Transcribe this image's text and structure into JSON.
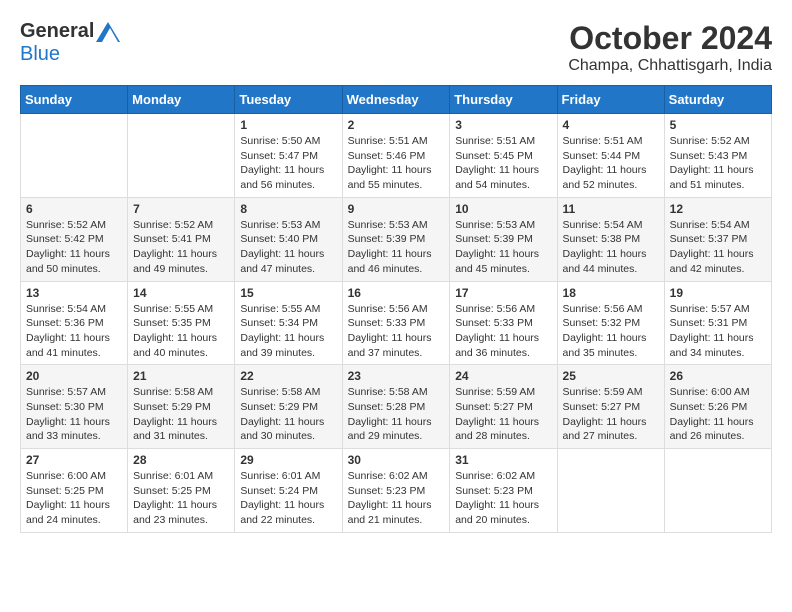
{
  "header": {
    "logo_general": "General",
    "logo_blue": "Blue",
    "month": "October 2024",
    "location": "Champa, Chhattisgarh, India"
  },
  "days_of_week": [
    "Sunday",
    "Monday",
    "Tuesday",
    "Wednesday",
    "Thursday",
    "Friday",
    "Saturday"
  ],
  "weeks": [
    [
      {
        "day": "",
        "content": ""
      },
      {
        "day": "",
        "content": ""
      },
      {
        "day": "1",
        "content": "Sunrise: 5:50 AM\nSunset: 5:47 PM\nDaylight: 11 hours and 56 minutes."
      },
      {
        "day": "2",
        "content": "Sunrise: 5:51 AM\nSunset: 5:46 PM\nDaylight: 11 hours and 55 minutes."
      },
      {
        "day": "3",
        "content": "Sunrise: 5:51 AM\nSunset: 5:45 PM\nDaylight: 11 hours and 54 minutes."
      },
      {
        "day": "4",
        "content": "Sunrise: 5:51 AM\nSunset: 5:44 PM\nDaylight: 11 hours and 52 minutes."
      },
      {
        "day": "5",
        "content": "Sunrise: 5:52 AM\nSunset: 5:43 PM\nDaylight: 11 hours and 51 minutes."
      }
    ],
    [
      {
        "day": "6",
        "content": "Sunrise: 5:52 AM\nSunset: 5:42 PM\nDaylight: 11 hours and 50 minutes."
      },
      {
        "day": "7",
        "content": "Sunrise: 5:52 AM\nSunset: 5:41 PM\nDaylight: 11 hours and 49 minutes."
      },
      {
        "day": "8",
        "content": "Sunrise: 5:53 AM\nSunset: 5:40 PM\nDaylight: 11 hours and 47 minutes."
      },
      {
        "day": "9",
        "content": "Sunrise: 5:53 AM\nSunset: 5:39 PM\nDaylight: 11 hours and 46 minutes."
      },
      {
        "day": "10",
        "content": "Sunrise: 5:53 AM\nSunset: 5:39 PM\nDaylight: 11 hours and 45 minutes."
      },
      {
        "day": "11",
        "content": "Sunrise: 5:54 AM\nSunset: 5:38 PM\nDaylight: 11 hours and 44 minutes."
      },
      {
        "day": "12",
        "content": "Sunrise: 5:54 AM\nSunset: 5:37 PM\nDaylight: 11 hours and 42 minutes."
      }
    ],
    [
      {
        "day": "13",
        "content": "Sunrise: 5:54 AM\nSunset: 5:36 PM\nDaylight: 11 hours and 41 minutes."
      },
      {
        "day": "14",
        "content": "Sunrise: 5:55 AM\nSunset: 5:35 PM\nDaylight: 11 hours and 40 minutes."
      },
      {
        "day": "15",
        "content": "Sunrise: 5:55 AM\nSunset: 5:34 PM\nDaylight: 11 hours and 39 minutes."
      },
      {
        "day": "16",
        "content": "Sunrise: 5:56 AM\nSunset: 5:33 PM\nDaylight: 11 hours and 37 minutes."
      },
      {
        "day": "17",
        "content": "Sunrise: 5:56 AM\nSunset: 5:33 PM\nDaylight: 11 hours and 36 minutes."
      },
      {
        "day": "18",
        "content": "Sunrise: 5:56 AM\nSunset: 5:32 PM\nDaylight: 11 hours and 35 minutes."
      },
      {
        "day": "19",
        "content": "Sunrise: 5:57 AM\nSunset: 5:31 PM\nDaylight: 11 hours and 34 minutes."
      }
    ],
    [
      {
        "day": "20",
        "content": "Sunrise: 5:57 AM\nSunset: 5:30 PM\nDaylight: 11 hours and 33 minutes."
      },
      {
        "day": "21",
        "content": "Sunrise: 5:58 AM\nSunset: 5:29 PM\nDaylight: 11 hours and 31 minutes."
      },
      {
        "day": "22",
        "content": "Sunrise: 5:58 AM\nSunset: 5:29 PM\nDaylight: 11 hours and 30 minutes."
      },
      {
        "day": "23",
        "content": "Sunrise: 5:58 AM\nSunset: 5:28 PM\nDaylight: 11 hours and 29 minutes."
      },
      {
        "day": "24",
        "content": "Sunrise: 5:59 AM\nSunset: 5:27 PM\nDaylight: 11 hours and 28 minutes."
      },
      {
        "day": "25",
        "content": "Sunrise: 5:59 AM\nSunset: 5:27 PM\nDaylight: 11 hours and 27 minutes."
      },
      {
        "day": "26",
        "content": "Sunrise: 6:00 AM\nSunset: 5:26 PM\nDaylight: 11 hours and 26 minutes."
      }
    ],
    [
      {
        "day": "27",
        "content": "Sunrise: 6:00 AM\nSunset: 5:25 PM\nDaylight: 11 hours and 24 minutes."
      },
      {
        "day": "28",
        "content": "Sunrise: 6:01 AM\nSunset: 5:25 PM\nDaylight: 11 hours and 23 minutes."
      },
      {
        "day": "29",
        "content": "Sunrise: 6:01 AM\nSunset: 5:24 PM\nDaylight: 11 hours and 22 minutes."
      },
      {
        "day": "30",
        "content": "Sunrise: 6:02 AM\nSunset: 5:23 PM\nDaylight: 11 hours and 21 minutes."
      },
      {
        "day": "31",
        "content": "Sunrise: 6:02 AM\nSunset: 5:23 PM\nDaylight: 11 hours and 20 minutes."
      },
      {
        "day": "",
        "content": ""
      },
      {
        "day": "",
        "content": ""
      }
    ]
  ]
}
